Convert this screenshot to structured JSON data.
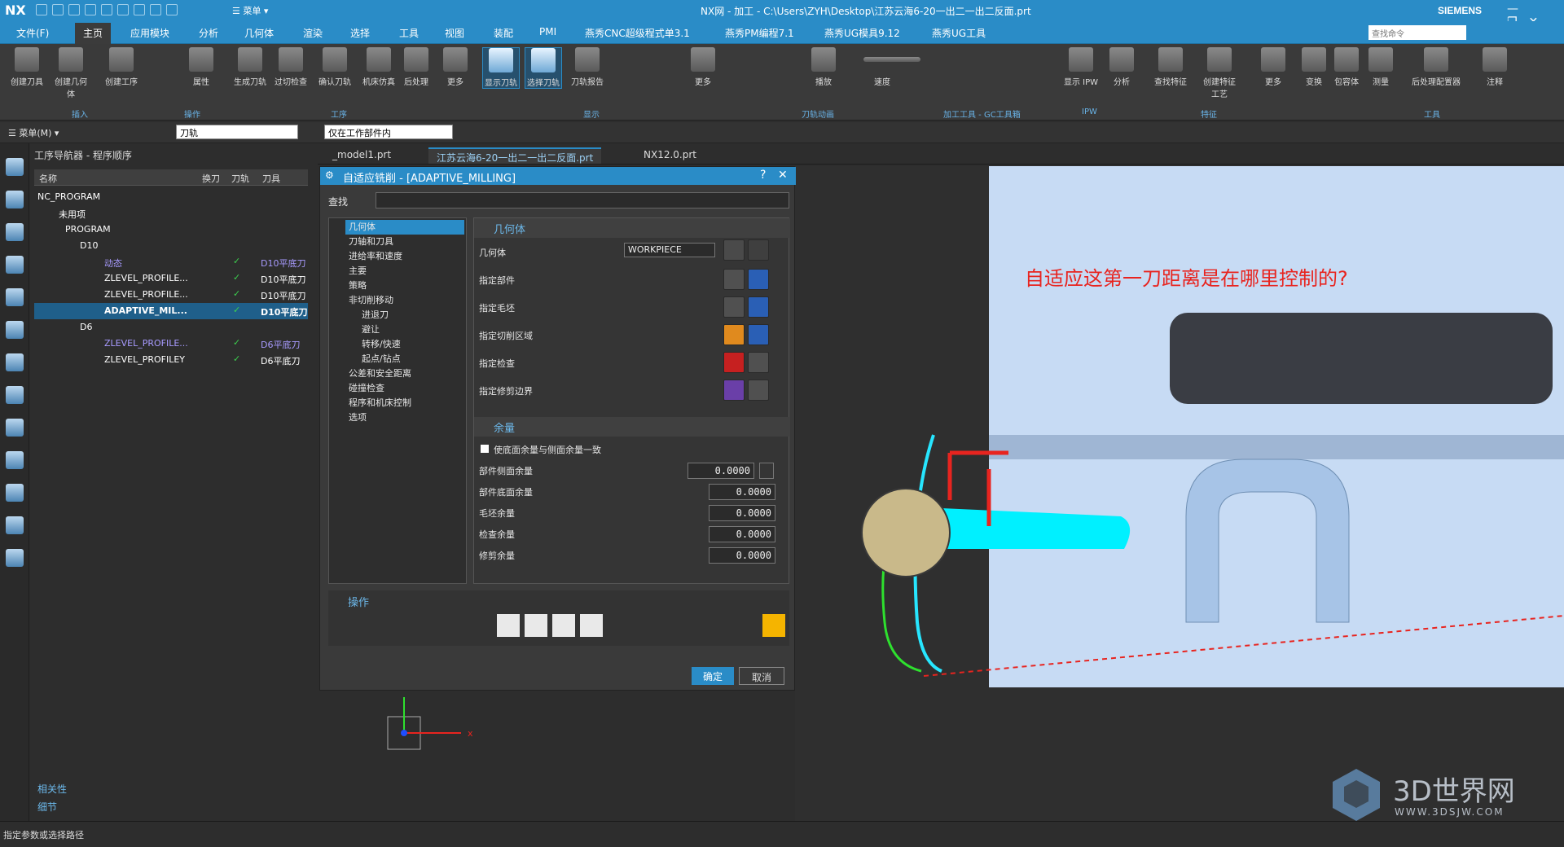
{
  "app": {
    "logo": "NX",
    "title": "NX网 - 加工 - C:\\Users\\ZYH\\Desktop\\江苏云海6-20一出二一出二反面.prt",
    "brand": "SIEMENS",
    "menu_label": "☰ 菜单 ▾"
  },
  "menu": [
    "文件(F)",
    "主页",
    "应用模块",
    "分析",
    "几何体",
    "渲染",
    "选择",
    "工具",
    "视图",
    "装配",
    "PMI",
    "燕秀CNC超级程式单3.1",
    "燕秀PM编程7.1",
    "燕秀UG模具9.12",
    "燕秀UG工具"
  ],
  "cmd_search_placeholder": "查找命令",
  "ribbon": {
    "buttons": [
      "创建刀具",
      "创建几何体",
      "创建工序",
      "属性",
      "生成刀轨",
      "过切检查",
      "确认刀轨",
      "机床仿真",
      "后处理",
      "更多",
      "显示刀轨",
      "选择刀轨",
      "刀轨报告",
      "更多",
      "播放",
      "速度",
      "显示 IPW",
      "分析",
      "查找特征",
      "创建特征工艺",
      "更多",
      "变换",
      "包容体",
      "测量",
      "后处理配置器",
      "注释"
    ],
    "groups": [
      "插入",
      "操作",
      "工序",
      "显示",
      "刀轨动画",
      "加工工具 - GC工具箱",
      "IPW",
      "特征",
      "工具"
    ]
  },
  "toolbar2": {
    "menu_label": "☰ 菜单(M) ▾",
    "filter": "刀轨",
    "scope": "仅在工作部件内"
  },
  "navigator": {
    "title": "工序导航器 - 程序顺序",
    "columns": [
      "名称",
      "换刀",
      "刀轨",
      "刀具"
    ],
    "rows": [
      {
        "name": "NC_PROGRAM",
        "check": "",
        "tool": ""
      },
      {
        "name": "未用项",
        "check": "",
        "tool": ""
      },
      {
        "name": "PROGRAM",
        "check": "",
        "tool": ""
      },
      {
        "name": "D10",
        "check": "",
        "tool": ""
      },
      {
        "name": "动态",
        "check": "✓",
        "tool": "D10平底刀"
      },
      {
        "name": "ZLEVEL_PROFILE...",
        "check": "✓",
        "tool": "D10平底刀"
      },
      {
        "name": "ZLEVEL_PROFILE...",
        "check": "✓",
        "tool": "D10平底刀"
      },
      {
        "name": "ADAPTIVE_MIL...",
        "check": "✓",
        "tool": "D10平底刀"
      },
      {
        "name": "D6",
        "check": "",
        "tool": ""
      },
      {
        "name": "ZLEVEL_PROFILE...",
        "check": "✓",
        "tool": "D6平底刀"
      },
      {
        "name": "ZLEVEL_PROFILEY",
        "check": "✓",
        "tool": "D6平底刀"
      }
    ],
    "bottom": [
      "相关性",
      "细节"
    ]
  },
  "file_tabs": [
    "_model1.prt",
    "江苏云海6-20一出二一出二反面.prt",
    "NX12.0.prt"
  ],
  "dialog": {
    "title": "自适应铣削 - [ADAPTIVE_MILLING]",
    "search_label": "查找",
    "tree": [
      "几何体",
      "刀轴和刀具",
      "进给率和速度",
      "主要",
      "策略",
      "非切削移动",
      "进退刀",
      "避让",
      "转移/快速",
      "起点/钻点",
      "公差和安全距离",
      "碰撞检查",
      "程序和机床控制",
      "选项"
    ],
    "geometry_section": "几何体",
    "geometry_label": "几何体",
    "geometry_value": "WORKPIECE",
    "geometry_rows": [
      "指定部件",
      "指定毛坯",
      "指定切削区域",
      "指定检查",
      "指定修剪边界"
    ],
    "stock_section": "余量",
    "stock_checkbox": "使底面余量与侧面余量一致",
    "stock_rows": [
      {
        "label": "部件侧面余量",
        "value": "0.0000"
      },
      {
        "label": "部件底面余量",
        "value": "0.0000"
      },
      {
        "label": "毛坯余量",
        "value": "0.0000"
      },
      {
        "label": "检查余量",
        "value": "0.0000"
      },
      {
        "label": "修剪余量",
        "value": "0.0000"
      }
    ],
    "ops_section": "操作",
    "ok": "确定",
    "cancel": "取消"
  },
  "viewport": {
    "question": "自适应这第一刀距离是在哪里控制的?",
    "axis_x": "x"
  },
  "status": "指定参数或选择路径",
  "watermark": {
    "name": "3D世界网",
    "url": "WWW.3DSJW.COM"
  }
}
